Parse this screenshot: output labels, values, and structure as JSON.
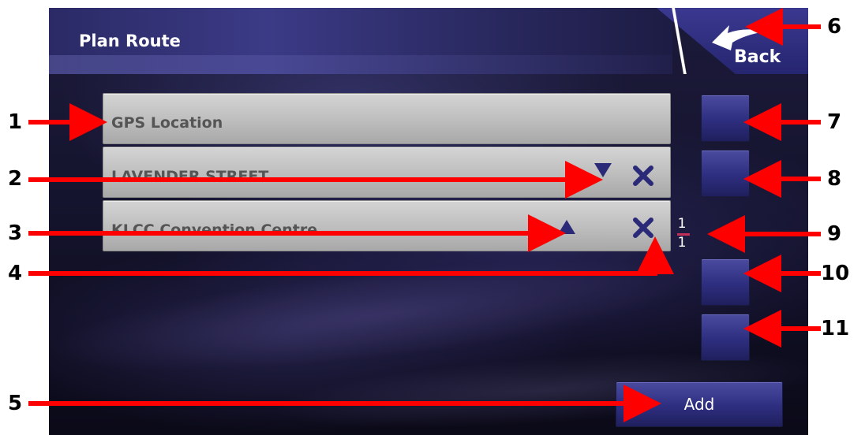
{
  "title": "Plan Route",
  "back": {
    "label": "Back"
  },
  "routes": [
    {
      "label": "GPS Location"
    },
    {
      "label": "LAVENDER STREET"
    },
    {
      "label": "KLCC Convention Centre"
    }
  ],
  "page_indicator": {
    "current": "1",
    "total": "1"
  },
  "add": {
    "label": "Add"
  },
  "callouts": [
    "1",
    "2",
    "3",
    "4",
    "5",
    "6",
    "7",
    "8",
    "9",
    "10",
    "11"
  ],
  "colors": {
    "accent": "#2e2e80",
    "row": "#bdbdbd",
    "annotation": "#ff0000",
    "indicator": "#c2305a"
  }
}
